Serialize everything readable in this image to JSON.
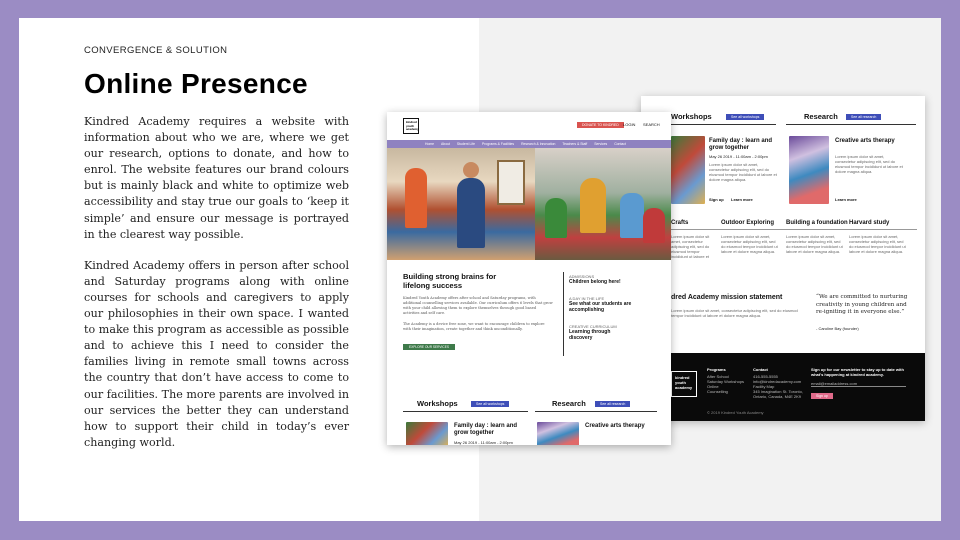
{
  "slide": {
    "eyebrow": "CONVERGENCE & SOLUTION",
    "title": "Online Presence",
    "paragraph1": "Kindred Academy requires a website with information about who we are, where we get our research, options to donate, and how to enrol. The website features our brand colours but is mainly black and white to optimize web accessibility and stay true our goals to ‘keep it simple’ and ensure our message is portrayed in the clearest way possible.",
    "paragraph2": "Kindred Academy offers in person after school and Saturday programs along with online courses for schools and caregivers to apply our philosophies in their own space. I wanted to make this program as accessible as possible and to achieve this I need to consider the families living in remote small towns across the country that don’t have access to come to our facilities. The more parents are involved in our services the better they can understand how to support their child in today’s ever changing world."
  },
  "colors": {
    "frame": "#9b8cc4",
    "accent_blue": "#3e4eb8",
    "accent_red": "#d9534f",
    "nav": "#8f82c0"
  },
  "mockup_front": {
    "logo": "kindred youth academy",
    "donate_btn": "DONATE TO KINDRED",
    "login": "LOGIN",
    "search": "SEARCH",
    "nav": [
      "Home",
      "About",
      "Student Life",
      "Programs & Facilities",
      "Research & Innovation",
      "Teachers & Staff",
      "Services",
      "Contact"
    ],
    "headline": "Building strong brains for lifelong success",
    "body1": "Kindred Youth Academy offers after school and Saturday programs, with additional counselling services available. Our curriculum offers 6 levels that grow with your child allowing them to explore themselves through good based activities and self care.",
    "body2": "The Academy is a device free zone, we want to encourage children to explore with their imagination, create together and think unconditionally.",
    "cta": "EXPLORE OUR SERVICES",
    "side": [
      {
        "label": "ADMISSIONS",
        "text": "Children belong here!"
      },
      {
        "label": "A DAY IN THE LIFE",
        "text": "See what our students are accomplishing"
      },
      {
        "label": "CREATIVE CURRICULUM",
        "text": "Learning through discovery"
      }
    ],
    "workshops": "Workshops",
    "research": "Research",
    "see_all": "See all workshops",
    "see_all_research": "See all research",
    "card1_title": "Family day : learn and grow together",
    "card1_date": "May 26 2019 - 11:00am - 2:00pm",
    "card2_title": "Creative arts therapy",
    "lorem": "Lorem ipsum dolor sit amet, consectetur adipiscing elit, sed do eiusmod tempor incididunt ut labore et dolore magna aliqua."
  },
  "mockup_back": {
    "workshops": "Workshops",
    "research": "Research",
    "see_all": "See all workshops",
    "see_all_research": "See all research",
    "card1_title": "Family day : learn and grow together",
    "card1_date": "May 26 2019 - 11:00am - 2:00pm",
    "card2_title": "Creative arts therapy",
    "signup": "Sign up",
    "learn_more": "Learn more",
    "row2": [
      "Crafts",
      "Outdoor Exploring",
      "Building a foundation",
      "Harvard study"
    ],
    "mission": "dred Academy mission statement",
    "quote": "“We are committed to nurturing creativity in young children and re-igniting it in everyone else.”",
    "quote_author": "- Caroline Bay (founder)",
    "footer_logo": "kindred youth academy",
    "footer_programs": "Programs",
    "footer_program_items": [
      "After School",
      "Saturday Workshops",
      "Online",
      "Counselling"
    ],
    "footer_contact": "Contact",
    "footer_contact_items": [
      "416-555-5555",
      "info@kindredacademy.com",
      "Facility Map",
      "345 Imagination St. Toronto, Ontario, Canada, M4E 2K9"
    ],
    "footer_signup": "Sign up for our newsletter to stay up to date with what's happening at kindred academy.",
    "footer_email": "email@emailaddress.com",
    "footer_btn": "Sign up",
    "copyright": "© 2019 Kindred Youth Academy"
  }
}
